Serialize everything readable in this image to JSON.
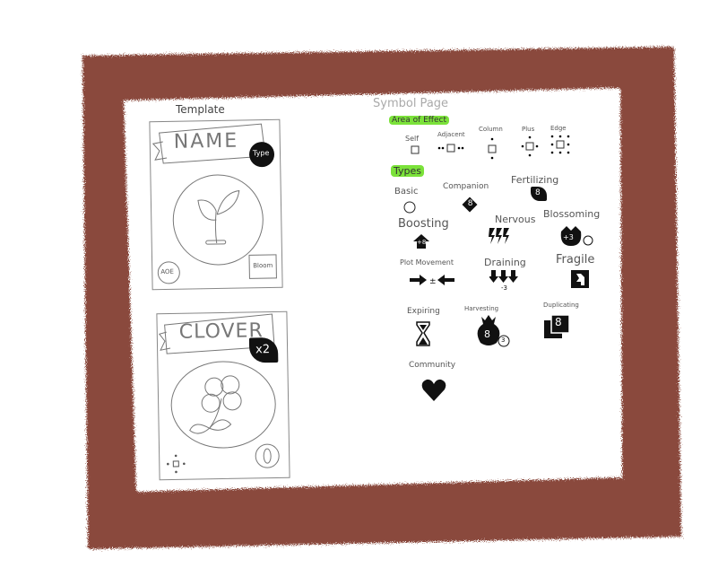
{
  "template_label": "Template",
  "cards": {
    "template": {
      "name": "NAME",
      "type_badge": "Type",
      "aoe": "AOE",
      "bottom_right": "Bloom"
    },
    "clover": {
      "name": "CLOVER",
      "type_badge": "x2"
    }
  },
  "symbol_page": {
    "title": "Symbol Page",
    "area_heading": "Area of Effect",
    "area_items": [
      "Self",
      "Adjacent",
      "Column",
      "Plus",
      "Edge"
    ],
    "types_heading": "Types",
    "types": [
      {
        "label": "Basic"
      },
      {
        "label": "Companion",
        "badge": "8"
      },
      {
        "label": "Fertilizing",
        "badge": "8"
      },
      {
        "label": "Boosting",
        "badge": "+8"
      },
      {
        "label": "Nervous"
      },
      {
        "label": "Blossoming",
        "badge": "+3"
      },
      {
        "label": "Plot Movement"
      },
      {
        "label": "Draining"
      },
      {
        "label": "Fragile"
      },
      {
        "label": "Expiring"
      },
      {
        "label": "Harvesting",
        "badge": "8",
        "sub_badge": "3"
      },
      {
        "label": "Duplicating",
        "badge": "8"
      },
      {
        "label": "Community"
      }
    ]
  },
  "colors": {
    "frame": "#8a4a3e",
    "highlight": "#7be23a",
    "pencil": "#777777",
    "ink": "#111111"
  }
}
